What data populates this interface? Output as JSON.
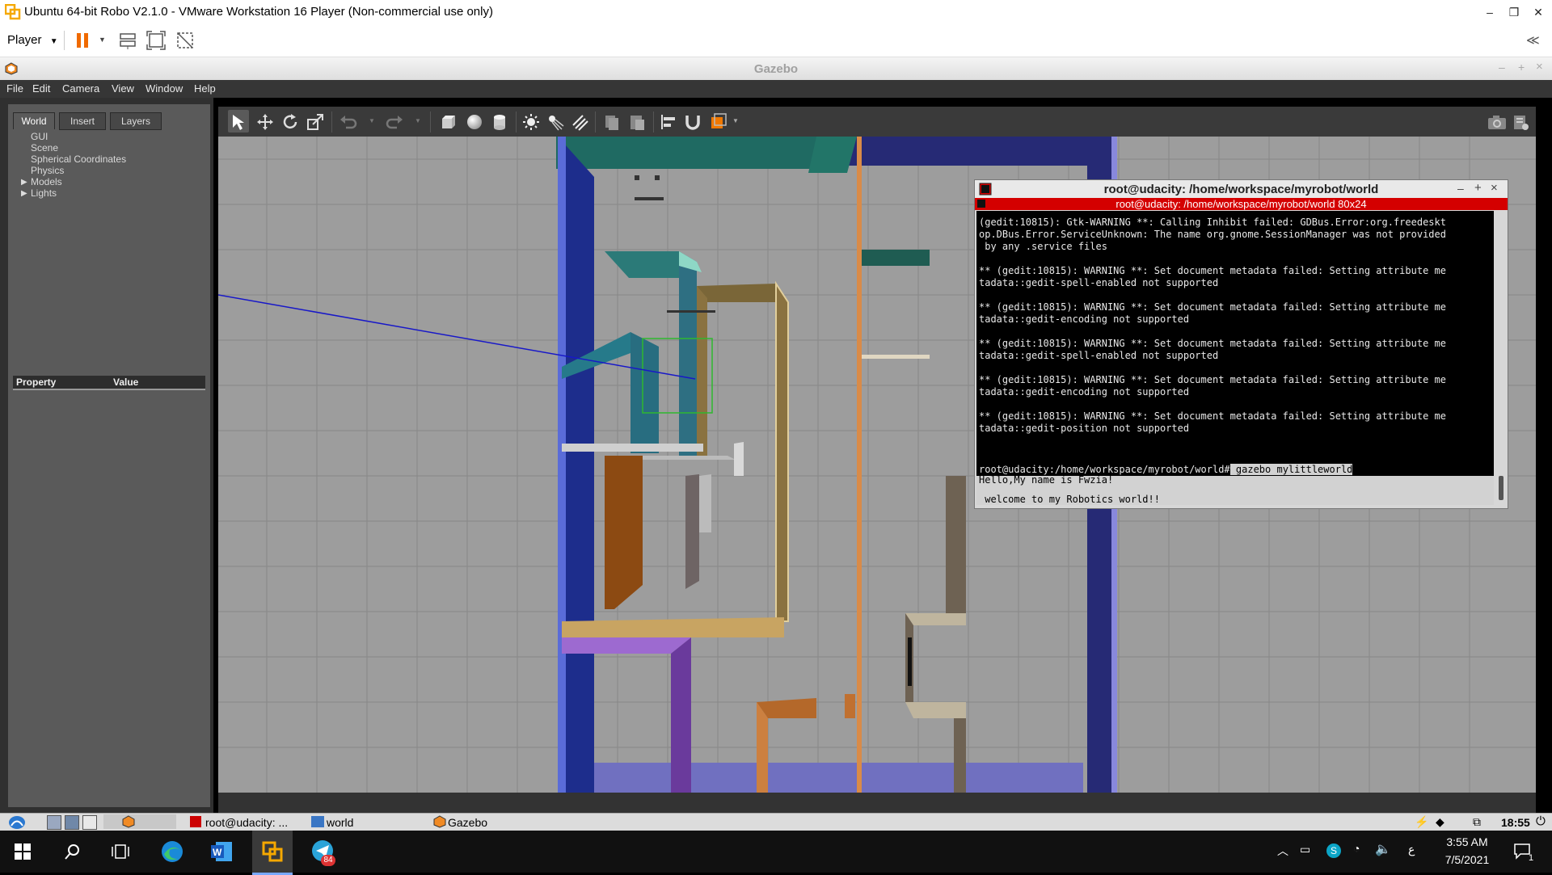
{
  "vmware": {
    "title": "Ubuntu 64-bit Robo V2.1.0 - VMware Workstation 16 Player (Non-commercial use only)",
    "player_label": "Player",
    "window_controls": {
      "minimize": "–",
      "restore": "❐",
      "close": "✕"
    },
    "collapse": "≪"
  },
  "gazebo": {
    "title": "Gazebo",
    "window_controls": {
      "minimize": "–",
      "maximize": "+",
      "close": "×"
    },
    "menu": [
      "File",
      "Edit",
      "Camera",
      "View",
      "Window",
      "Help"
    ],
    "tabs": [
      "World",
      "Insert",
      "Layers"
    ],
    "tree": [
      "GUI",
      "Scene",
      "Spherical Coordinates",
      "Physics",
      "Models",
      "Lights"
    ],
    "property_header": {
      "property": "Property",
      "value": "Value"
    }
  },
  "terminal": {
    "title": "root@udacity: /home/workspace/myrobot/world",
    "tab_title": "root@udacity: /home/workspace/myrobot/world 80x24",
    "window_controls": {
      "minimize": "–",
      "maximize": "+",
      "close": "×"
    },
    "lines": [
      "(gedit:10815): Gtk-WARNING **: Calling Inhibit failed: GDBus.Error:org.freedeskt",
      "op.DBus.Error.ServiceUnknown: The name org.gnome.SessionManager was not provided",
      " by any .service files",
      "",
      "** (gedit:10815): WARNING **: Set document metadata failed: Setting attribute me",
      "tadata::gedit-spell-enabled not supported",
      "",
      "** (gedit:10815): WARNING **: Set document metadata failed: Setting attribute me",
      "tadata::gedit-encoding not supported",
      "",
      "** (gedit:10815): WARNING **: Set document metadata failed: Setting attribute me",
      "tadata::gedit-spell-enabled not supported",
      "",
      "** (gedit:10815): WARNING **: Set document metadata failed: Setting attribute me",
      "tadata::gedit-encoding not supported",
      "",
      "** (gedit:10815): WARNING **: Set document metadata failed: Setting attribute me",
      "tadata::gedit-position not supported"
    ],
    "prompt": "root@udacity:/home/workspace/myrobot/world#",
    "command": " gazebo mylittleworld",
    "output": [
      "Hello,My name is Fwzia!",
      "",
      " welcome to my Robotics world!!"
    ]
  },
  "ubuntu_taskbar": {
    "items": [
      "root@udacity: ...",
      "world",
      "Gazebo"
    ],
    "clock": "18:55"
  },
  "windows_taskbar": {
    "time": "3:55 AM",
    "date": "7/5/2021",
    "telegram_badge": "84",
    "notification_count": "1",
    "lang": "ع"
  }
}
